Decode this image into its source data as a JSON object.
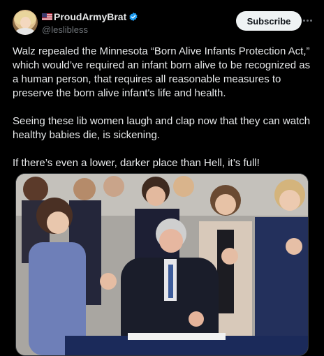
{
  "author": {
    "display_name": "ProudArmyBrat",
    "handle": "@leslibless",
    "flag": "us-flag-icon",
    "verified": "verified-badge-icon"
  },
  "actions": {
    "subscribe_label": "Subscribe",
    "more": "more-icon"
  },
  "post": {
    "paragraphs": [
      "Walz repealed the Minnesota “Born Alive Infants Protection Act,” which would’ve required an infant born alive to be recognized as a human person, that requires all reasonable measures to preserve the born alive infant's life and health.",
      "Seeing these lib women laugh and clap now that they can watch healthy babies die, is sickening.",
      "If there’s even a lower, darker place than Hell, it’s full!"
    ]
  },
  "colors": {
    "background": "#000000",
    "text": "#e7e9ea",
    "muted": "#71767b",
    "verified": "#1d9bf0"
  }
}
